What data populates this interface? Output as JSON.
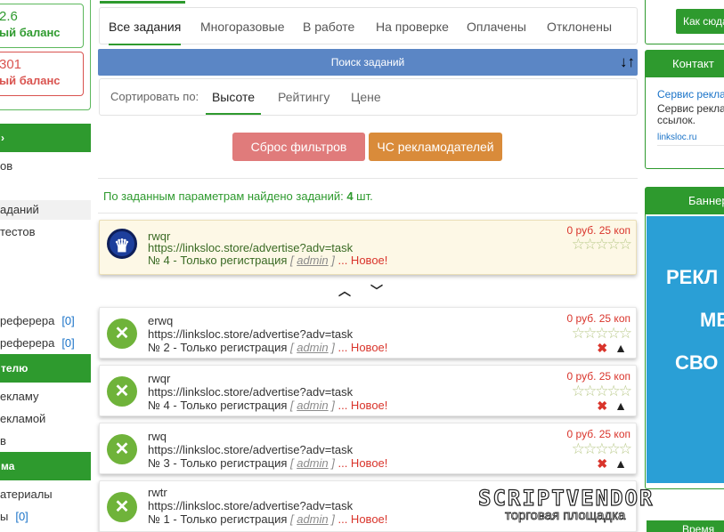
{
  "left": {
    "balance1": {
      "amount": "2.6",
      "label": "ый баланс"
    },
    "balance2": {
      "amount": "301",
      "label": "ый баланс"
    },
    "section1": "",
    "items1": [
      "ов",
      "",
      "аданий",
      "тестов"
    ],
    "items2": [
      {
        "label": "реферера",
        "count": "[0]"
      },
      {
        "label": "реферера",
        "count": "[0]"
      }
    ],
    "section2": "телю",
    "items3": [
      "екламу",
      "екламой",
      "в"
    ],
    "section3": "ма",
    "items4": [
      {
        "label": "атериалы",
        "count": ""
      },
      {
        "label": "ы",
        "count": "[0]"
      }
    ]
  },
  "tabs": [
    "Все задания",
    "Многоразовые",
    "В работе",
    "На проверке",
    "Оплачены",
    "Отклонены"
  ],
  "search": {
    "label": "Поиск заданий",
    "icon": "sort-icon"
  },
  "sort": {
    "label": "Сортировать по:",
    "options": [
      "Высоте",
      "Рейтингу",
      "Цене"
    ]
  },
  "buttons": {
    "reset": "Сброс фильтров",
    "blacklist": "ЧС рекламодателей"
  },
  "found": {
    "prefix": "По заданным параметрам найдено заданий: ",
    "count": "4",
    "suffix": " шт."
  },
  "tasks": [
    {
      "title": "rwqr",
      "url": "https://linksloc.store/advertise?adv=task",
      "num": "№ 4 - Только регистрация ",
      "admin": "admin",
      "status": " ... Новое!",
      "price": "0 руб. 25 коп",
      "rating": 0,
      "icon": "crown-icon"
    },
    {
      "title": "erwq",
      "url": "https://linksloc.store/advertise?adv=task",
      "num": "№ 2 - Только регистрация ",
      "admin": "admin",
      "status": " ... Новое!",
      "price": "0 руб. 25 коп",
      "rating": 0,
      "icon": "tools-icon"
    },
    {
      "title": "rwqr",
      "url": "https://linksloc.store/advertise?adv=task",
      "num": "№ 4 - Только регистрация ",
      "admin": "admin",
      "status": " ... Новое!",
      "price": "0 руб. 25 коп",
      "rating": 0,
      "icon": "tools-icon"
    },
    {
      "title": "rwq",
      "url": "https://linksloc.store/advertise?adv=task",
      "num": "№ 3 - Только регистрация ",
      "admin": "admin",
      "status": " ... Новое!",
      "price": "0 руб. 25 коп",
      "rating": 0,
      "icon": "tools-icon"
    },
    {
      "title": "rwtr",
      "url": "https://linksloc.store/advertise?adv=task",
      "num": "№ 1 - Только регистрация ",
      "admin": "admin",
      "status": " ... Новое!",
      "price": "",
      "rating": 0,
      "icon": "tools-icon"
    }
  ],
  "right": {
    "here_button": "Как сюда",
    "contacts_title": "Контакт",
    "contacts_lines": [
      "Сервис рекла",
      "Сервис рекла",
      "ссылок.",
      "linksloc.ru"
    ],
    "banner_title": "Баннер",
    "banner_words": [
      "РЕКЛ",
      "МЕ",
      "СВО"
    ],
    "bottom_title": "Время"
  },
  "watermark": {
    "line1": "SCRIPTVENDOR",
    "line2": "торговая площадка"
  },
  "colors": {
    "green": "#2e9a2e",
    "blue_bar": "#5b86c5",
    "reset": "#e07b7b",
    "blacklist": "#d98b3a",
    "red": "#d9342b"
  }
}
